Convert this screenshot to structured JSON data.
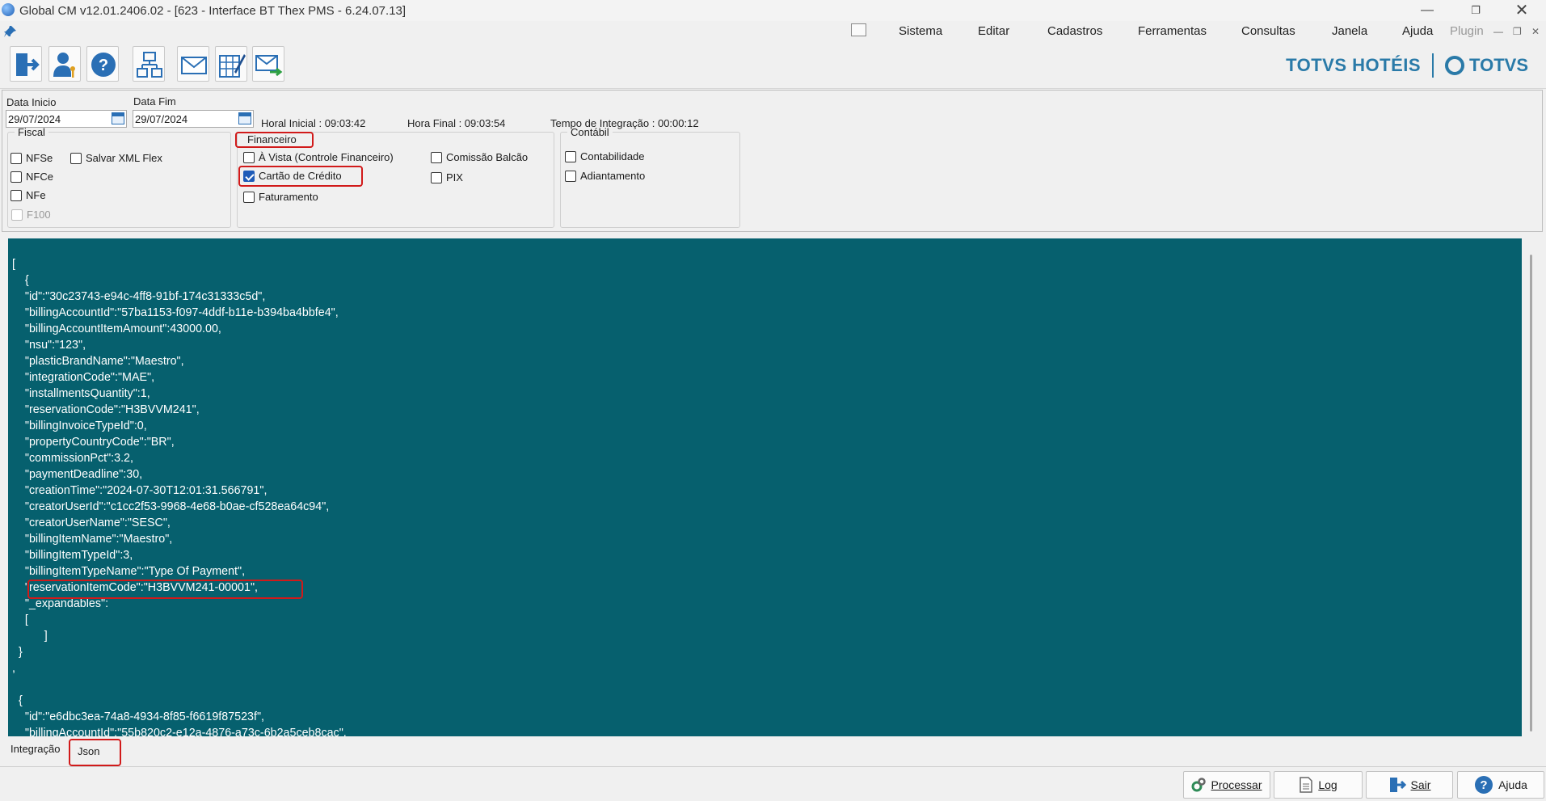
{
  "window": {
    "title": "Global CM v12.01.2406.02 - [623 - Interface BT Thex PMS - 6.24.07.13]"
  },
  "menu": {
    "items": [
      "Sistema",
      "Editar",
      "Cadastros",
      "Ferramentas",
      "Consultas",
      "Janela",
      "Ajuda",
      "Plugin"
    ]
  },
  "brand": {
    "hotels": "TOTVS HOTÉIS",
    "totvs": "TOTVS"
  },
  "filters": {
    "data_inicio_label": "Data Inicio",
    "data_inicio_value": "29/07/2024",
    "data_fim_label": "Data Fim",
    "data_fim_value": "29/07/2024",
    "horal_inicial": "Horal Inicial : 09:03:42",
    "hora_final": "Hora Final : 09:03:54",
    "tempo": "Tempo de Integração :  00:00:12"
  },
  "fiscal": {
    "legend": "Fiscal",
    "options": [
      {
        "label": "NFSe",
        "checked": false
      },
      {
        "label": "Salvar XML Flex",
        "checked": false
      },
      {
        "label": "NFCe",
        "checked": false
      },
      {
        "label": "NFe",
        "checked": false
      },
      {
        "label": "F100",
        "checked": false,
        "disabled": true
      }
    ]
  },
  "financeiro": {
    "legend": "Financeiro",
    "options": [
      {
        "label": "À Vista (Controle Financeiro)",
        "checked": false
      },
      {
        "label": "Comissão Balcão",
        "checked": false
      },
      {
        "label": "Cartão de Crédito",
        "checked": true
      },
      {
        "label": "PIX",
        "checked": false
      },
      {
        "label": "Faturamento",
        "checked": false
      }
    ]
  },
  "contabil": {
    "legend": "Contábil",
    "options": [
      {
        "label": "Contabilidade",
        "checked": false
      },
      {
        "label": "Adiantamento",
        "checked": false
      }
    ]
  },
  "json_text": "[\n    {\n    \"id\":\"30c23743-e94c-4ff8-91bf-174c31333c5d\",\n    \"billingAccountId\":\"57ba1153-f097-4ddf-b11e-b394ba4bbfe4\",\n    \"billingAccountItemAmount\":43000.00,\n    \"nsu\":\"123\",\n    \"plasticBrandName\":\"Maestro\",\n    \"integrationCode\":\"MAE\",\n    \"installmentsQuantity\":1,\n    \"reservationCode\":\"H3BVVM241\",\n    \"billingInvoiceTypeId\":0,\n    \"propertyCountryCode\":\"BR\",\n    \"commissionPct\":3.2,\n    \"paymentDeadline\":30,\n    \"creationTime\":\"2024-07-30T12:01:31.566791\",\n    \"creatorUserId\":\"c1cc2f53-9968-4e68-b0ae-cf528ea64c94\",\n    \"creatorUserName\":\"SESC\",\n    \"billingItemName\":\"Maestro\",\n    \"billingItemTypeId\":3,\n    \"billingItemTypeName\":\"Type Of Payment\",\n    \"reservationItemCode\":\"H3BVVM241-00001\",\n    \"_expandables\":\n    [\n          ]\n  }\n,\n\n  {\n    \"id\":\"e6dbc3ea-74a8-4934-8f85-f6619f87523f\",\n    \"billingAccountId\":\"55b820c2-e12a-4876-a73c-6b2a5ceb8cac\",",
  "tabs": [
    "Integração",
    "Json"
  ],
  "buttons": {
    "processar": "Processar",
    "log": "Log",
    "sair": "Sair",
    "ajuda": "Ajuda"
  }
}
